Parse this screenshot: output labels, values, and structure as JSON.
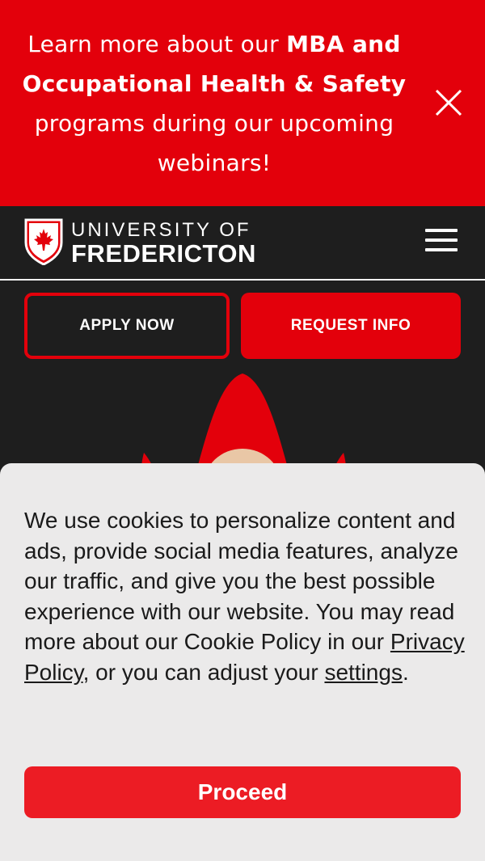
{
  "banner": {
    "text_lead": "Learn more about our ",
    "text_bold": "MBA and Occupational Health & Safety",
    "text_tail": " programs during our upcoming webinars!",
    "close_icon": "close-icon"
  },
  "header": {
    "logo_top": "UNIVERSITY OF",
    "logo_bottom": "FREDERICTON",
    "logo_icon": "maple-leaf-shield-icon",
    "menu_icon": "hamburger-menu-icon"
  },
  "cta": {
    "apply_label": "APPLY NOW",
    "request_label": "REQUEST INFO"
  },
  "cookie": {
    "text_part1": "We use cookies to personalize content and ads, provide social media features, analyze our traffic, and give you the best possible experience with our website. You may read more about our Cookie Policy in our ",
    "privacy_link": "Privacy Policy",
    "text_part2": ", or you can adjust your ",
    "settings_link": "settings",
    "text_part3": ".",
    "proceed_label": "Proceed"
  },
  "colors": {
    "brand_red": "#e3000b",
    "dark_bg": "#1e1e1e",
    "cookie_bg": "#ebeaea"
  }
}
